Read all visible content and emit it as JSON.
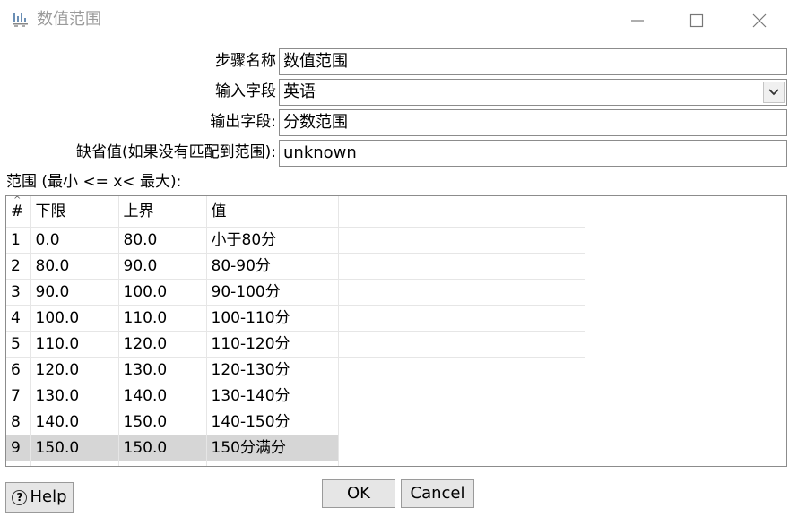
{
  "window": {
    "title": "数值范围",
    "minimize": "—",
    "maximize": "☐",
    "close": "✕"
  },
  "form": {
    "step_name_label": "步骤名称",
    "step_name_value": "数值范围",
    "input_field_label": "输入字段",
    "input_field_value": "英语",
    "output_field_label": "输出字段:",
    "output_field_value": "分数范围",
    "default_value_label": "缺省值(如果没有匹配到范围):",
    "default_value_value": "unknown"
  },
  "range_table": {
    "caption": "范围 (最小 <= x< 最大):",
    "columns": [
      "#",
      "下限",
      "上界",
      "值"
    ],
    "rows": [
      {
        "idx": "1",
        "lower": "0.0",
        "upper": "80.0",
        "value": "小于80分"
      },
      {
        "idx": "2",
        "lower": "80.0",
        "upper": "90.0",
        "value": "80-90分"
      },
      {
        "idx": "3",
        "lower": "90.0",
        "upper": "100.0",
        "value": "90-100分"
      },
      {
        "idx": "4",
        "lower": "100.0",
        "upper": "110.0",
        "value": "100-110分"
      },
      {
        "idx": "5",
        "lower": "110.0",
        "upper": "120.0",
        "value": "110-120分"
      },
      {
        "idx": "6",
        "lower": "120.0",
        "upper": "130.0",
        "value": "120-130分"
      },
      {
        "idx": "7",
        "lower": "130.0",
        "upper": "140.0",
        "value": "130-140分"
      },
      {
        "idx": "8",
        "lower": "140.0",
        "upper": "150.0",
        "value": "140-150分"
      },
      {
        "idx": "9",
        "lower": "150.0",
        "upper": "150.0",
        "value": "150分满分"
      }
    ],
    "selected_row": "9"
  },
  "buttons": {
    "help": "Help",
    "ok": "OK",
    "cancel": "Cancel"
  },
  "icons": {
    "app": "app-step-icon",
    "dropdown": "chevron-down-icon",
    "help": "question-circle-icon",
    "sort": "sort-caret-icon"
  }
}
